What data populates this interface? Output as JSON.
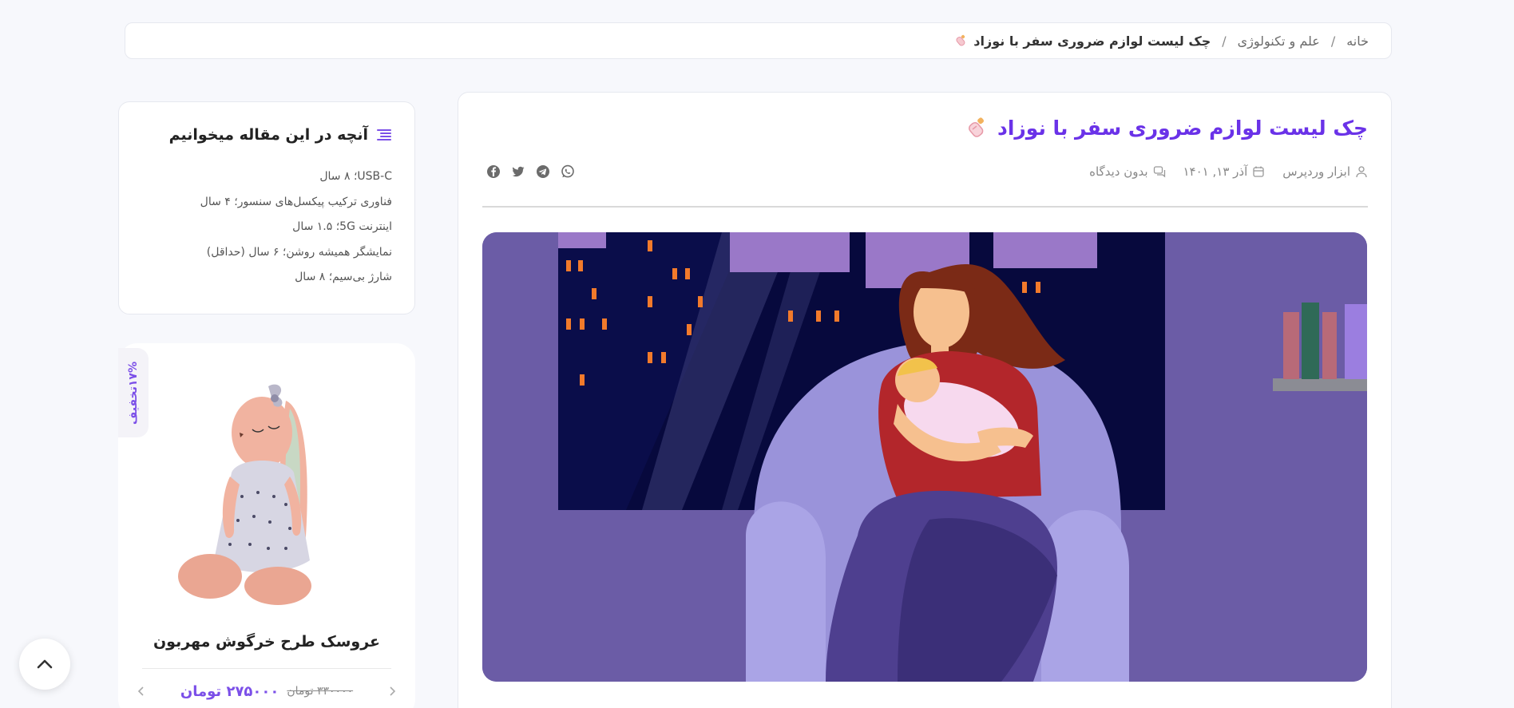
{
  "breadcrumb": {
    "home": "خانه",
    "category": "علم و تکنولوژی",
    "current": "چک لیست لوازم ضروری سفر با نوزاد",
    "separator": "/"
  },
  "article": {
    "title": "چک لیست لوازم ضروری سفر با نوزاد",
    "author": "ابزار وردپرس",
    "date": "آذر ۱۳, ۱۴۰۱",
    "comments": "بدون دیدگاه",
    "share_icons": [
      "facebook-icon",
      "twitter-icon",
      "telegram-icon",
      "whatsapp-icon"
    ]
  },
  "toc": {
    "title": "آنچه در این مقاله میخوانیم",
    "items": [
      "USB-C؛ ۸ سال",
      "فناوری ترکیب پیکسل‌های سنسور؛ ۴ سال",
      "اینترنت 5G؛ ۱.۵ سال",
      "نمایشگر همیشه روشن؛ ۶ سال (حداقل)",
      "شارژ بی‌سیم؛ ۸ سال"
    ]
  },
  "product": {
    "discount": "۱۷%تخفیف",
    "name": "عروسک طرح خرگوش مهربون",
    "price_new": "۲۷۵۰۰۰ تومان",
    "price_old": "۳۳۰۰۰۰ تومان"
  },
  "colors": {
    "accent": "#6a32e8",
    "background": "#f7f8fc"
  }
}
